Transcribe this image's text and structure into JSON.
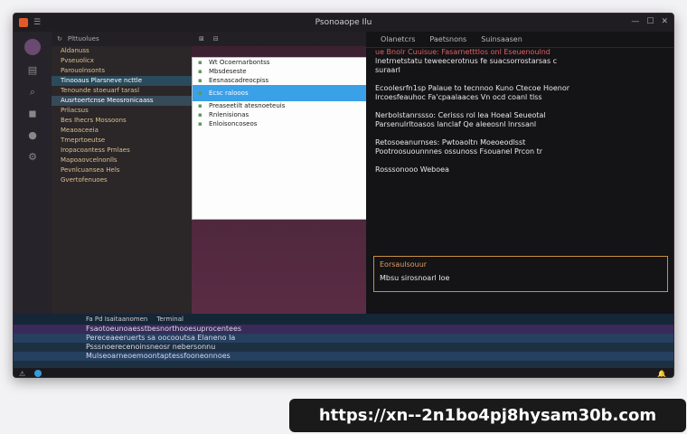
{
  "window": {
    "title": "Psonoaope Ilu"
  },
  "sidebar": {
    "header": "Plttuolues",
    "items": [
      {
        "label": "Aldanuss",
        "state": ""
      },
      {
        "label": "Pvseuolicx",
        "state": ""
      },
      {
        "label": "Parouolnsonts",
        "state": ""
      },
      {
        "label": "Tinooaus Plarsneve ncttle",
        "state": "active"
      },
      {
        "label": "Tenounde stoeuarf tarasl",
        "state": ""
      },
      {
        "label": "Ausrtoertcnse Meosronicaass",
        "state": "sel"
      },
      {
        "label": "Prliacsus",
        "state": ""
      },
      {
        "label": "Bes Ihecrs Mossoons",
        "state": ""
      },
      {
        "label": "Meaoaceeia",
        "state": ""
      },
      {
        "label": "Tmeprtoeutse",
        "state": ""
      },
      {
        "label": "Iropacoantess Prnlaes",
        "state": ""
      },
      {
        "label": "Mapoaovcelnonlls",
        "state": ""
      },
      {
        "label": "Pevnlcuansea Hels",
        "state": ""
      },
      {
        "label": "Gvertofenuoes",
        "state": ""
      }
    ]
  },
  "popup": {
    "items": [
      {
        "label": "Wt Ocoernarbontss",
        "hl": false
      },
      {
        "label": "Mbsdeseste",
        "hl": false
      },
      {
        "label": "Eesnascadreocpiss",
        "hl": false
      },
      {
        "label": "Ecsc ralooos",
        "hl": true
      },
      {
        "label": "Preaseetilt atesnoeteuis",
        "hl": false
      },
      {
        "label": "Rnlenisionas",
        "hl": false
      },
      {
        "label": "Enloisoncoseos",
        "hl": false
      }
    ]
  },
  "panel": {
    "tabs": [
      "Olanetcrs",
      "Paetsnons",
      "Suinsaasen"
    ],
    "lines": [
      "ue Bnolr Cuuisue: Fasarnetttlos onl Eseuenoulnd",
      "lnetrnetstatu teweecerotnus fe suacsorrostarsas c",
      "suraarl",
      "",
      "Ecoolesrfn1sp Palaue to tecnnoo Kuno Ctecoe Hoenor",
      "Ircoesfeauhoc Fa'cpaalaaces Vn ocd coanl tlss",
      "",
      "Nerbolstanrssso: Cerisss rol lea Hoeal Seueotal",
      "Parsenulrltoasos lanclaf Qe aleeosnl lnrssanl",
      "",
      "Retosoeanurnses: Pwtoaoltn Moeoeodlsst",
      "Pootroosuounnnes ossunoss Fsouanel Prcon tr",
      "",
      "Rosssonooo Weboea"
    ],
    "boxed": {
      "title": "Eorsaulsouur",
      "body": "Mbsu sirosnoarl Ioe"
    }
  },
  "bottom": {
    "header": [
      "Fa Pd Isaitaanomen",
      "Terminal"
    ],
    "rows": [
      {
        "label": "Fsaotoeunoaesstbesnorthooesuprocentees",
        "state": "sel"
      },
      {
        "label": "Pereceaeeruerts sa oocooutsa Elaneno Ia",
        "state": "hl"
      },
      {
        "label": "Psssnoerecenoinsneosr nebersonnu",
        "state": ""
      },
      {
        "label": "Mulseoarneoemoontaptessfooneonnoes",
        "state": "hl"
      }
    ]
  },
  "watermark": {
    "url": "https://xn--2n1bo4pj8hysam30b.com"
  }
}
